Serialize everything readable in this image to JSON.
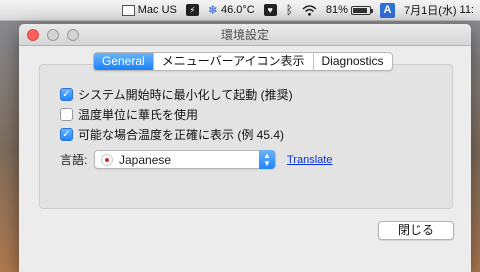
{
  "menubar": {
    "input_source": "Mac US",
    "temperature": "46.0°C",
    "battery_percent": "81%",
    "input_method": "A",
    "date": "7月1日(水)",
    "time": "11:"
  },
  "window": {
    "title": "環境設定",
    "tabs": [
      {
        "label": "General",
        "active": true
      },
      {
        "label": "メニューバーアイコン表示",
        "active": false
      },
      {
        "label": "Diagnostics",
        "active": false
      }
    ],
    "options": [
      {
        "label": "システム開始時に最小化して起動 (推奨)",
        "checked": true
      },
      {
        "label": "温度単位に華氏を使用",
        "checked": false
      },
      {
        "label": "可能な場合温度を正確に表示 (例 45.4)",
        "checked": true
      }
    ],
    "language": {
      "label": "言語:",
      "selected": "Japanese",
      "link": "Translate"
    },
    "close_button": "閉じる"
  },
  "colors": {
    "accent": "#1a82fb",
    "link": "#0b31d8",
    "close_dot": "#fc605c"
  }
}
